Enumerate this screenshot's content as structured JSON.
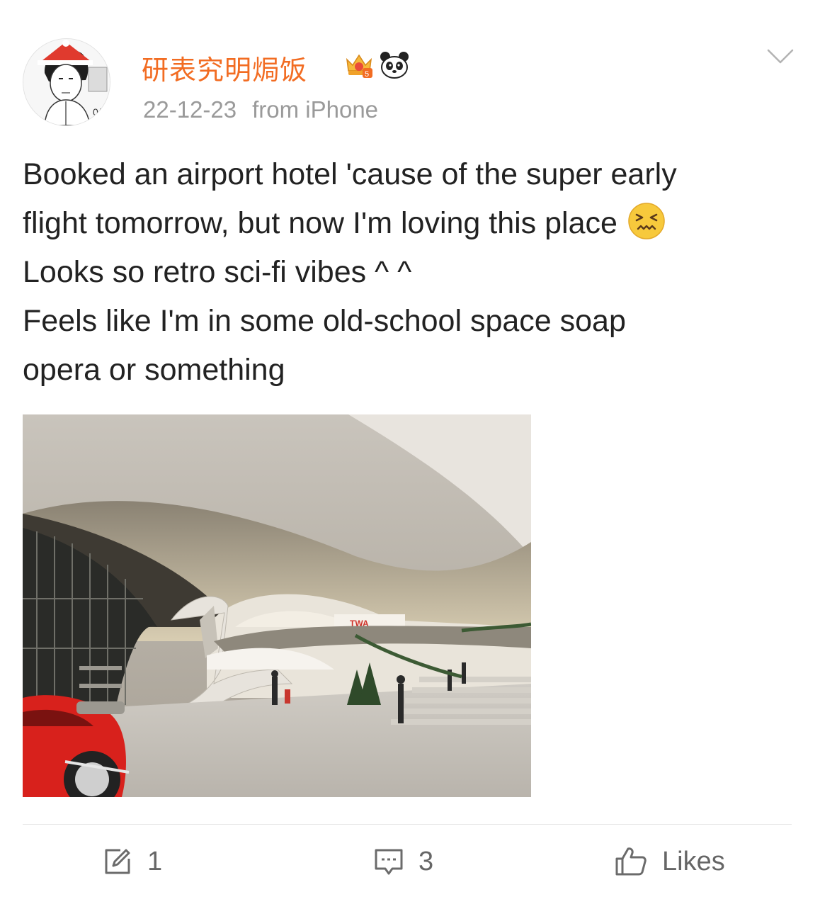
{
  "post": {
    "author": {
      "name": "研表究明焗饭",
      "avatar_icon": "avatar-icon",
      "badges": [
        "crown-badge-icon",
        "panda-badge-icon"
      ],
      "name_color": "#f26c22"
    },
    "date": "22-12-23",
    "source": "from iPhone",
    "text_lines": [
      "Booked an airport hotel 'cause of the super early",
      "flight tomorrow, but now I'm loving this place",
      "Looks so retro sci-fi vibes ^ ^",
      "Feels like I'm in some old-school space soap",
      "opera or something"
    ],
    "image": {
      "sign_text": "TWA"
    }
  },
  "actions": {
    "repost_count": "1",
    "comment_count": "3",
    "like_label": "Likes"
  },
  "icons": {
    "more": "chevron-down-icon",
    "emoji": "confounded-face-icon",
    "repost": "repost-icon",
    "comment": "comment-icon",
    "like": "thumbs-up-icon"
  }
}
